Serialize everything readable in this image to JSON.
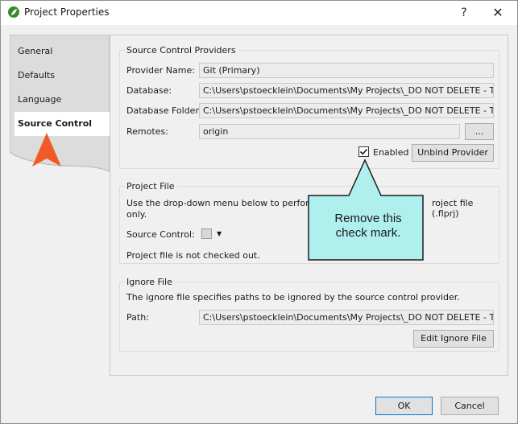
{
  "window": {
    "title": "Project Properties",
    "help_label": "?",
    "close_label": "✕"
  },
  "sidebar": {
    "items": [
      {
        "label": "General"
      },
      {
        "label": "Defaults"
      },
      {
        "label": "Language"
      },
      {
        "label": "Source Control",
        "selected": true
      }
    ]
  },
  "providers": {
    "title": "Source Control Providers",
    "provider_name_label": "Provider Name:",
    "provider_name_value": "Git (Primary)",
    "database_label": "Database:",
    "database_value": "C:\\Users\\pstoecklein\\Documents\\My Projects\\_DO NOT DELETE - Test Branc",
    "database_folder_label": "Database Folder:",
    "database_folder_value": "C:\\Users\\pstoecklein\\Documents\\My Projects\\_DO NOT DELETE - Test Branc",
    "remotes_label": "Remotes:",
    "remotes_value": "origin",
    "browse_label": "...",
    "enabled_label": "Enabled",
    "enabled_checked": true,
    "unbind_label": "Unbind Provider"
  },
  "project_file": {
    "title": "Project File",
    "description_left": "Use the drop-down menu below to perform sour",
    "description_right": "roject file (.flprj)",
    "description_line2": "only.",
    "source_control_label": "Source Control:",
    "status": "Project file is not checked out."
  },
  "ignore_file": {
    "title": "Ignore File",
    "description": "The ignore file specifies paths to be ignored by the source control provider.",
    "path_label": "Path:",
    "path_value": "C:\\Users\\pstoecklein\\Documents\\My Projects\\_DO NOT DELETE - Test Branc",
    "edit_label": "Edit Ignore File"
  },
  "footer": {
    "ok_label": "OK",
    "cancel_label": "Cancel"
  },
  "callout": {
    "text_line1": "Remove this",
    "text_line2": "check mark."
  },
  "colors": {
    "callout_fill": "#aff0ef",
    "arrow_marker": "#f05a28",
    "accent_border": "#0078d7"
  }
}
